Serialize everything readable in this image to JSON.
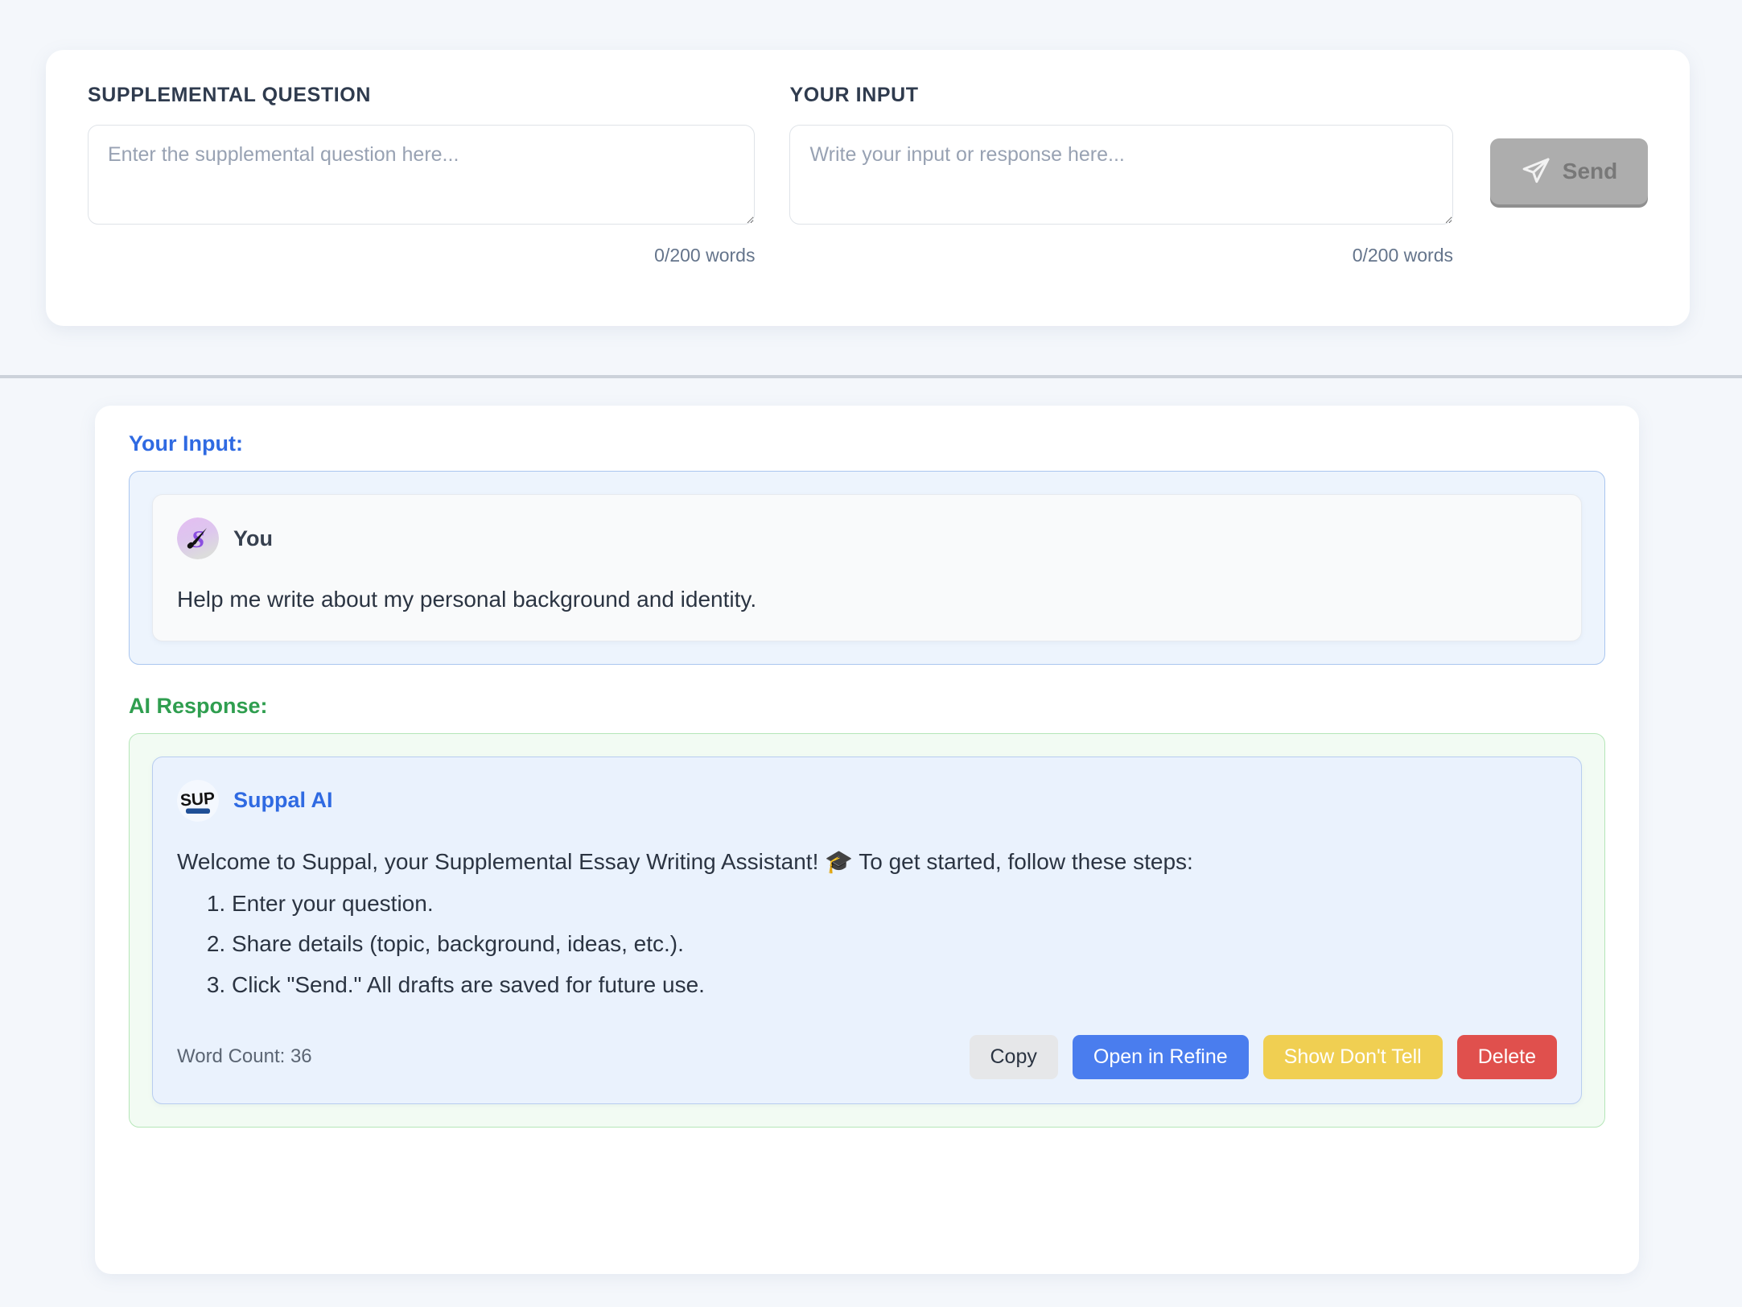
{
  "composer": {
    "supplemental": {
      "label": "SUPPLEMENTAL QUESTION",
      "placeholder": "Enter the supplemental question here...",
      "value": "",
      "word_count": "0/200 words"
    },
    "your_input": {
      "label": "YOUR INPUT",
      "placeholder": "Write your input or response here...",
      "value": "",
      "word_count": "0/200 words"
    },
    "send_button": {
      "label": "Send",
      "icon": "send-paper-plane-icon",
      "disabled": true,
      "color": "#adadad"
    }
  },
  "conversation": {
    "user_section": {
      "title": "Your Input:",
      "title_color": "#2f6ae2",
      "sender": "You",
      "avatar_icon": "suppal-paintbrush-avatar-icon",
      "message": "Help me write about my personal background and identity."
    },
    "ai_section": {
      "title": "AI Response:",
      "title_color": "#2f9e4f",
      "sender": "Suppal AI",
      "avatar_icon": "suppal-sup-logo-icon",
      "intro": "Welcome to Suppal, your Supplemental Essay Writing Assistant! 🎓 To get started, follow these steps:",
      "steps": [
        "Enter your question.",
        "Share details (topic, background, ideas, etc.).",
        "Click \"Send.\" All drafts are saved for future use."
      ],
      "word_count": "Word Count: 36",
      "buttons": [
        {
          "label": "Copy",
          "color": "#e6e7e9"
        },
        {
          "label": "Open in Refine",
          "color": "#4a7dee"
        },
        {
          "label": "Show Don't Tell",
          "color": "#f0cf52"
        },
        {
          "label": "Delete",
          "color": "#e0504d"
        }
      ]
    }
  }
}
